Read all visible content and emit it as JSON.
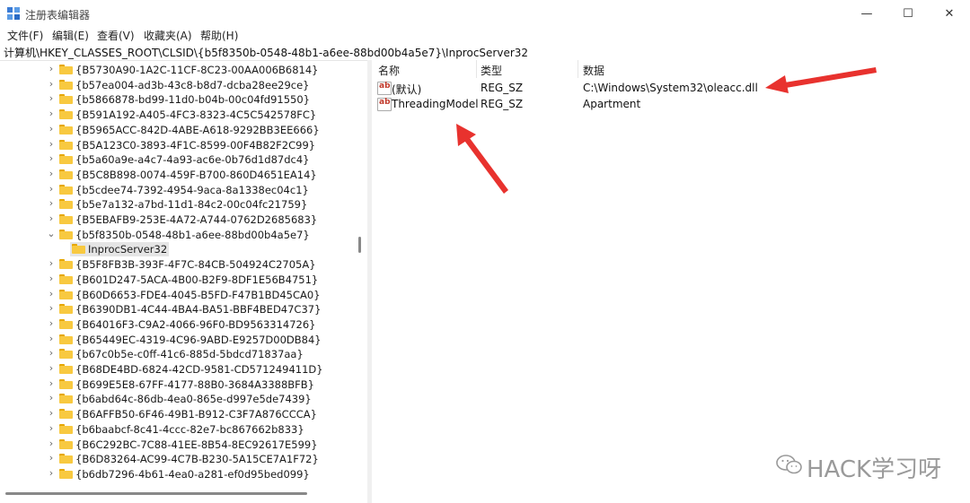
{
  "window": {
    "title": "注册表编辑器",
    "controls": {
      "minimize": "—",
      "maximize": "☐",
      "close": "✕"
    }
  },
  "menu": [
    "文件(F)",
    "编辑(E)",
    "查看(V)",
    "收藏夹(A)",
    "帮助(H)"
  ],
  "address": "计算机\\HKEY_CLASSES_ROOT\\CLSID\\{b5f8350b-0548-48b1-a6ee-88bd00b4a5e7}\\InprocServer32",
  "tree": {
    "nodes": [
      {
        "label": "{B5730A90-1A2C-11CF-8C23-00AA006B6814}",
        "state": "collapsed"
      },
      {
        "label": "{b57ea004-ad3b-43c8-b8d7-dcba28ee29ce}",
        "state": "collapsed"
      },
      {
        "label": "{b5866878-bd99-11d0-b04b-00c04fd91550}",
        "state": "collapsed"
      },
      {
        "label": "{B591A192-A405-4FC3-8323-4C5C542578FC}",
        "state": "collapsed"
      },
      {
        "label": "{B5965ACC-842D-4ABE-A618-9292BB3EE666}",
        "state": "collapsed"
      },
      {
        "label": "{B5A123C0-3893-4F1C-8599-00F4B82F2C99}",
        "state": "collapsed"
      },
      {
        "label": "{b5a60a9e-a4c7-4a93-ac6e-0b76d1d87dc4}",
        "state": "collapsed"
      },
      {
        "label": "{B5C8B898-0074-459F-B700-860D4651EA14}",
        "state": "collapsed"
      },
      {
        "label": "{b5cdee74-7392-4954-9aca-8a1338ec04c1}",
        "state": "collapsed"
      },
      {
        "label": "{b5e7a132-a7bd-11d1-84c2-00c04fc21759}",
        "state": "collapsed"
      },
      {
        "label": "{B5EBAFB9-253E-4A72-A744-0762D2685683}",
        "state": "collapsed"
      },
      {
        "label": "{b5f8350b-0548-48b1-a6ee-88bd00b4a5e7}",
        "state": "expanded"
      },
      {
        "label": "InprocServer32",
        "state": "selected-child"
      },
      {
        "label": "{B5F8FB3B-393F-4F7C-84CB-504924C2705A}",
        "state": "collapsed"
      },
      {
        "label": "{B601D247-5ACA-4B00-B2F9-8DF1E56B4751}",
        "state": "collapsed"
      },
      {
        "label": "{B60D6653-FDE4-4045-B5FD-F47B1BD45CA0}",
        "state": "collapsed"
      },
      {
        "label": "{B6390DB1-4C44-4BA4-BA51-BBF4BED47C37}",
        "state": "collapsed"
      },
      {
        "label": "{B64016F3-C9A2-4066-96F0-BD9563314726}",
        "state": "collapsed"
      },
      {
        "label": "{B65449EC-4319-4C96-9ABD-E9257D00DB84}",
        "state": "collapsed"
      },
      {
        "label": "{b67c0b5e-c0ff-41c6-885d-5bdcd71837aa}",
        "state": "collapsed"
      },
      {
        "label": "{B68DE4BD-6824-42CD-9581-CD571249411D}",
        "state": "collapsed"
      },
      {
        "label": "{B699E5E8-67FF-4177-88B0-3684A3388BFB}",
        "state": "collapsed"
      },
      {
        "label": "{b6abd64c-86db-4ea0-865e-d997e5de7439}",
        "state": "collapsed"
      },
      {
        "label": "{B6AFFB50-6F46-49B1-B912-C3F7A876CCCA}",
        "state": "collapsed"
      },
      {
        "label": "{b6baabcf-8c41-4ccc-82e7-bc867662b833}",
        "state": "collapsed"
      },
      {
        "label": "{B6C292BC-7C88-41EE-8B54-8EC92617E599}",
        "state": "collapsed"
      },
      {
        "label": "{B6D83264-AC99-4C7B-B230-5A15CE7A1F72}",
        "state": "collapsed"
      },
      {
        "label": "{b6db7296-4b61-4ea0-a281-ef0d95bed099}",
        "state": "collapsed"
      }
    ]
  },
  "values": {
    "columns": [
      "名称",
      "类型",
      "数据"
    ],
    "rows": [
      {
        "name": "(默认)",
        "type": "REG_SZ",
        "data": "C:\\Windows\\System32\\oleacc.dll",
        "icon": "ab-string-icon"
      },
      {
        "name": "ThreadingModel",
        "type": "REG_SZ",
        "data": "Apartment",
        "icon": "ab-string-icon"
      }
    ]
  },
  "watermark": "HACK学习呀",
  "colors": {
    "arrow": "#e8322e",
    "folder": "#f8c940",
    "selected": "#e5e5e5"
  }
}
